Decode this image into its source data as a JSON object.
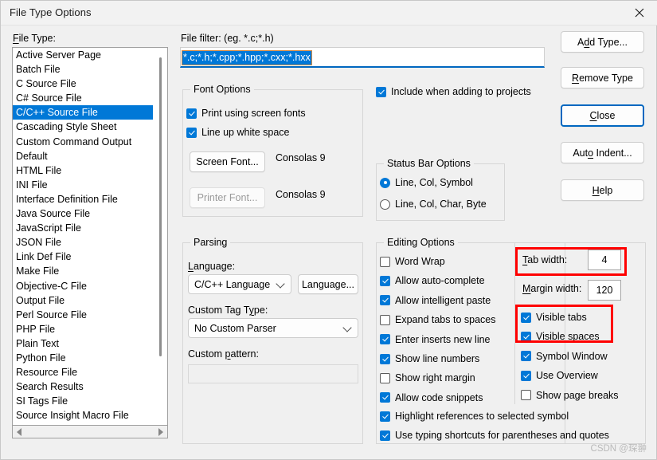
{
  "window": {
    "title": "File Type Options",
    "close_icon": "close-icon"
  },
  "file_type": {
    "label": "File Type:",
    "selected": "C/C++ Source File",
    "items": [
      "Active Server Page",
      "Batch File",
      "C Source File",
      "C# Source File",
      "C/C++ Source File",
      "Cascading Style Sheet",
      "Custom Command Output",
      "Default",
      "HTML File",
      "INI File",
      "Interface Definition File",
      "Java Source File",
      "JavaScript File",
      "JSON File",
      "Link Def File",
      "Make File",
      "Objective-C File",
      "Output File",
      "Perl Source File",
      "PHP File",
      "Plain Text",
      "Python File",
      "Resource File",
      "Search Results",
      "SI Tags File",
      "Source Insight Macro File"
    ]
  },
  "file_filter": {
    "label": "File filter: (eg. *.c;*.h)",
    "value": "*.c;*.h;*.cpp;*.hpp;*.cxx;*.hxx",
    "placeholder": "*.c;*.h"
  },
  "font_options": {
    "title": "Font Options",
    "print_using_screen_fonts": {
      "label": "Print using screen fonts",
      "checked": true
    },
    "line_up_white_space": {
      "label": "Line up white space",
      "checked": true
    },
    "screen_font_button": "Screen Font...",
    "screen_font_value": "Consolas 9",
    "printer_font_button": "Printer Font...",
    "printer_font_value": "Consolas 9"
  },
  "include_when_adding": {
    "label": "Include when adding to projects",
    "checked": true
  },
  "status_bar_options": {
    "title": "Status Bar Options",
    "selected": "Line, Col, Symbol",
    "options": [
      {
        "label": "Line, Col, Symbol",
        "checked": true
      },
      {
        "label": "Line, Col, Char, Byte",
        "checked": false
      }
    ]
  },
  "parsing": {
    "title": "Parsing",
    "language_label": "Language:",
    "language_value": "C/C++ Language",
    "language_button": "Language...",
    "custom_tag_label": "Custom Tag Type:",
    "custom_tag_value": "No Custom Parser",
    "custom_pattern_label": "Custom pattern:",
    "custom_pattern_value": ""
  },
  "editing_options": {
    "title": "Editing Options",
    "left_column": [
      {
        "label": "Word Wrap",
        "checked": false
      },
      {
        "label": "Allow auto-complete",
        "checked": true
      },
      {
        "label": "Allow intelligent paste",
        "checked": true
      },
      {
        "label": "Expand tabs to spaces",
        "checked": false
      },
      {
        "label": "Enter inserts new line",
        "checked": true
      },
      {
        "label": "Show line numbers",
        "checked": true
      },
      {
        "label": "Show right margin",
        "checked": false
      },
      {
        "label": "Allow code snippets",
        "checked": true
      }
    ],
    "full_width": [
      {
        "label": "Highlight references to selected symbol",
        "checked": true
      },
      {
        "label": "Use typing shortcuts for parentheses and quotes",
        "checked": true
      }
    ],
    "tab_width_label": "Tab width:",
    "tab_width_value": "4",
    "margin_width_label": "Margin width:",
    "margin_width_value": "120",
    "right_column": [
      {
        "label": "Visible tabs",
        "checked": true
      },
      {
        "label": "Visible spaces",
        "checked": true
      },
      {
        "label": "Symbol Window",
        "checked": true
      },
      {
        "label": "Use Overview",
        "checked": true
      },
      {
        "label": "Show page breaks",
        "checked": false
      }
    ]
  },
  "buttons": {
    "add_type": "Add Type...",
    "remove_type": "Remove Type",
    "close": "Close",
    "auto_indent": "Auto Indent...",
    "help": "Help"
  },
  "annotations": {
    "highlight_color": "#ff0000"
  },
  "watermark": "CSDN @琛翀"
}
